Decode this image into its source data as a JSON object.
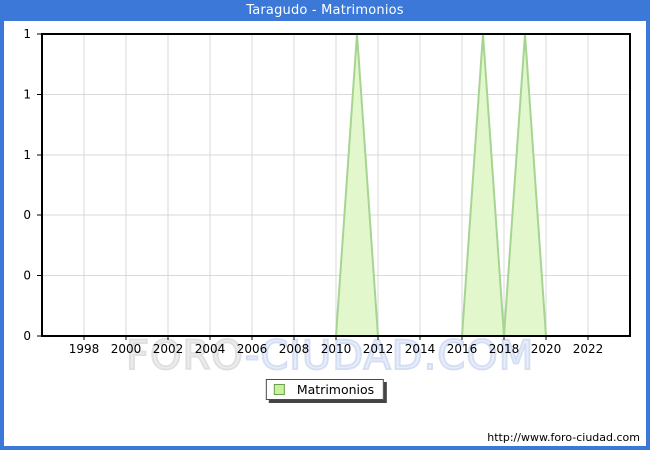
{
  "header": {
    "title": "Taragudo - Matrimonios"
  },
  "colors": {
    "frame_blue": "#3b78d8",
    "grid": "#d9d9d9",
    "plot_border": "#000000",
    "area_fill": "#e3f7cd",
    "area_stroke": "#a6d592",
    "legend_swatch_fill": "#c6f29b",
    "legend_swatch_border": "#6f9e50"
  },
  "chart_data": {
    "type": "area",
    "title": "Taragudo - Matrimonios",
    "x": [
      1996,
      1997,
      1998,
      1999,
      2000,
      2001,
      2002,
      2003,
      2004,
      2005,
      2006,
      2007,
      2008,
      2009,
      2010,
      2011,
      2012,
      2013,
      2014,
      2015,
      2016,
      2017,
      2018,
      2019,
      2020,
      2021,
      2022,
      2023
    ],
    "series": [
      {
        "name": "Matrimonios",
        "values": [
          0,
          0,
          0,
          0,
          0,
          0,
          0,
          0,
          0,
          0,
          0,
          0,
          0,
          0,
          0,
          1,
          0,
          0,
          0,
          0,
          0,
          1,
          0,
          1,
          0,
          0,
          0,
          0
        ]
      }
    ],
    "x_tick_labels": [
      "1998",
      "2000",
      "2002",
      "2004",
      "2006",
      "2008",
      "2010",
      "2012",
      "2014",
      "2016",
      "2018",
      "2020",
      "2022"
    ],
    "y_ticks": {
      "labels_top_to_bottom": [
        "1",
        "1",
        "1",
        "0",
        "0",
        "0"
      ],
      "values_top_to_bottom": [
        1,
        0.8,
        0.6,
        0.4,
        0.2,
        0
      ]
    },
    "xlim": [
      1996,
      2024
    ],
    "ylim": [
      0,
      1
    ],
    "grid": true,
    "legend": {
      "label": "Matrimonios",
      "position": "bottom-center"
    }
  },
  "watermark": {
    "part1": "FORO",
    "part2": "-CIUDAD.COM"
  },
  "footer": {
    "url": "http://www.foro-ciudad.com"
  }
}
